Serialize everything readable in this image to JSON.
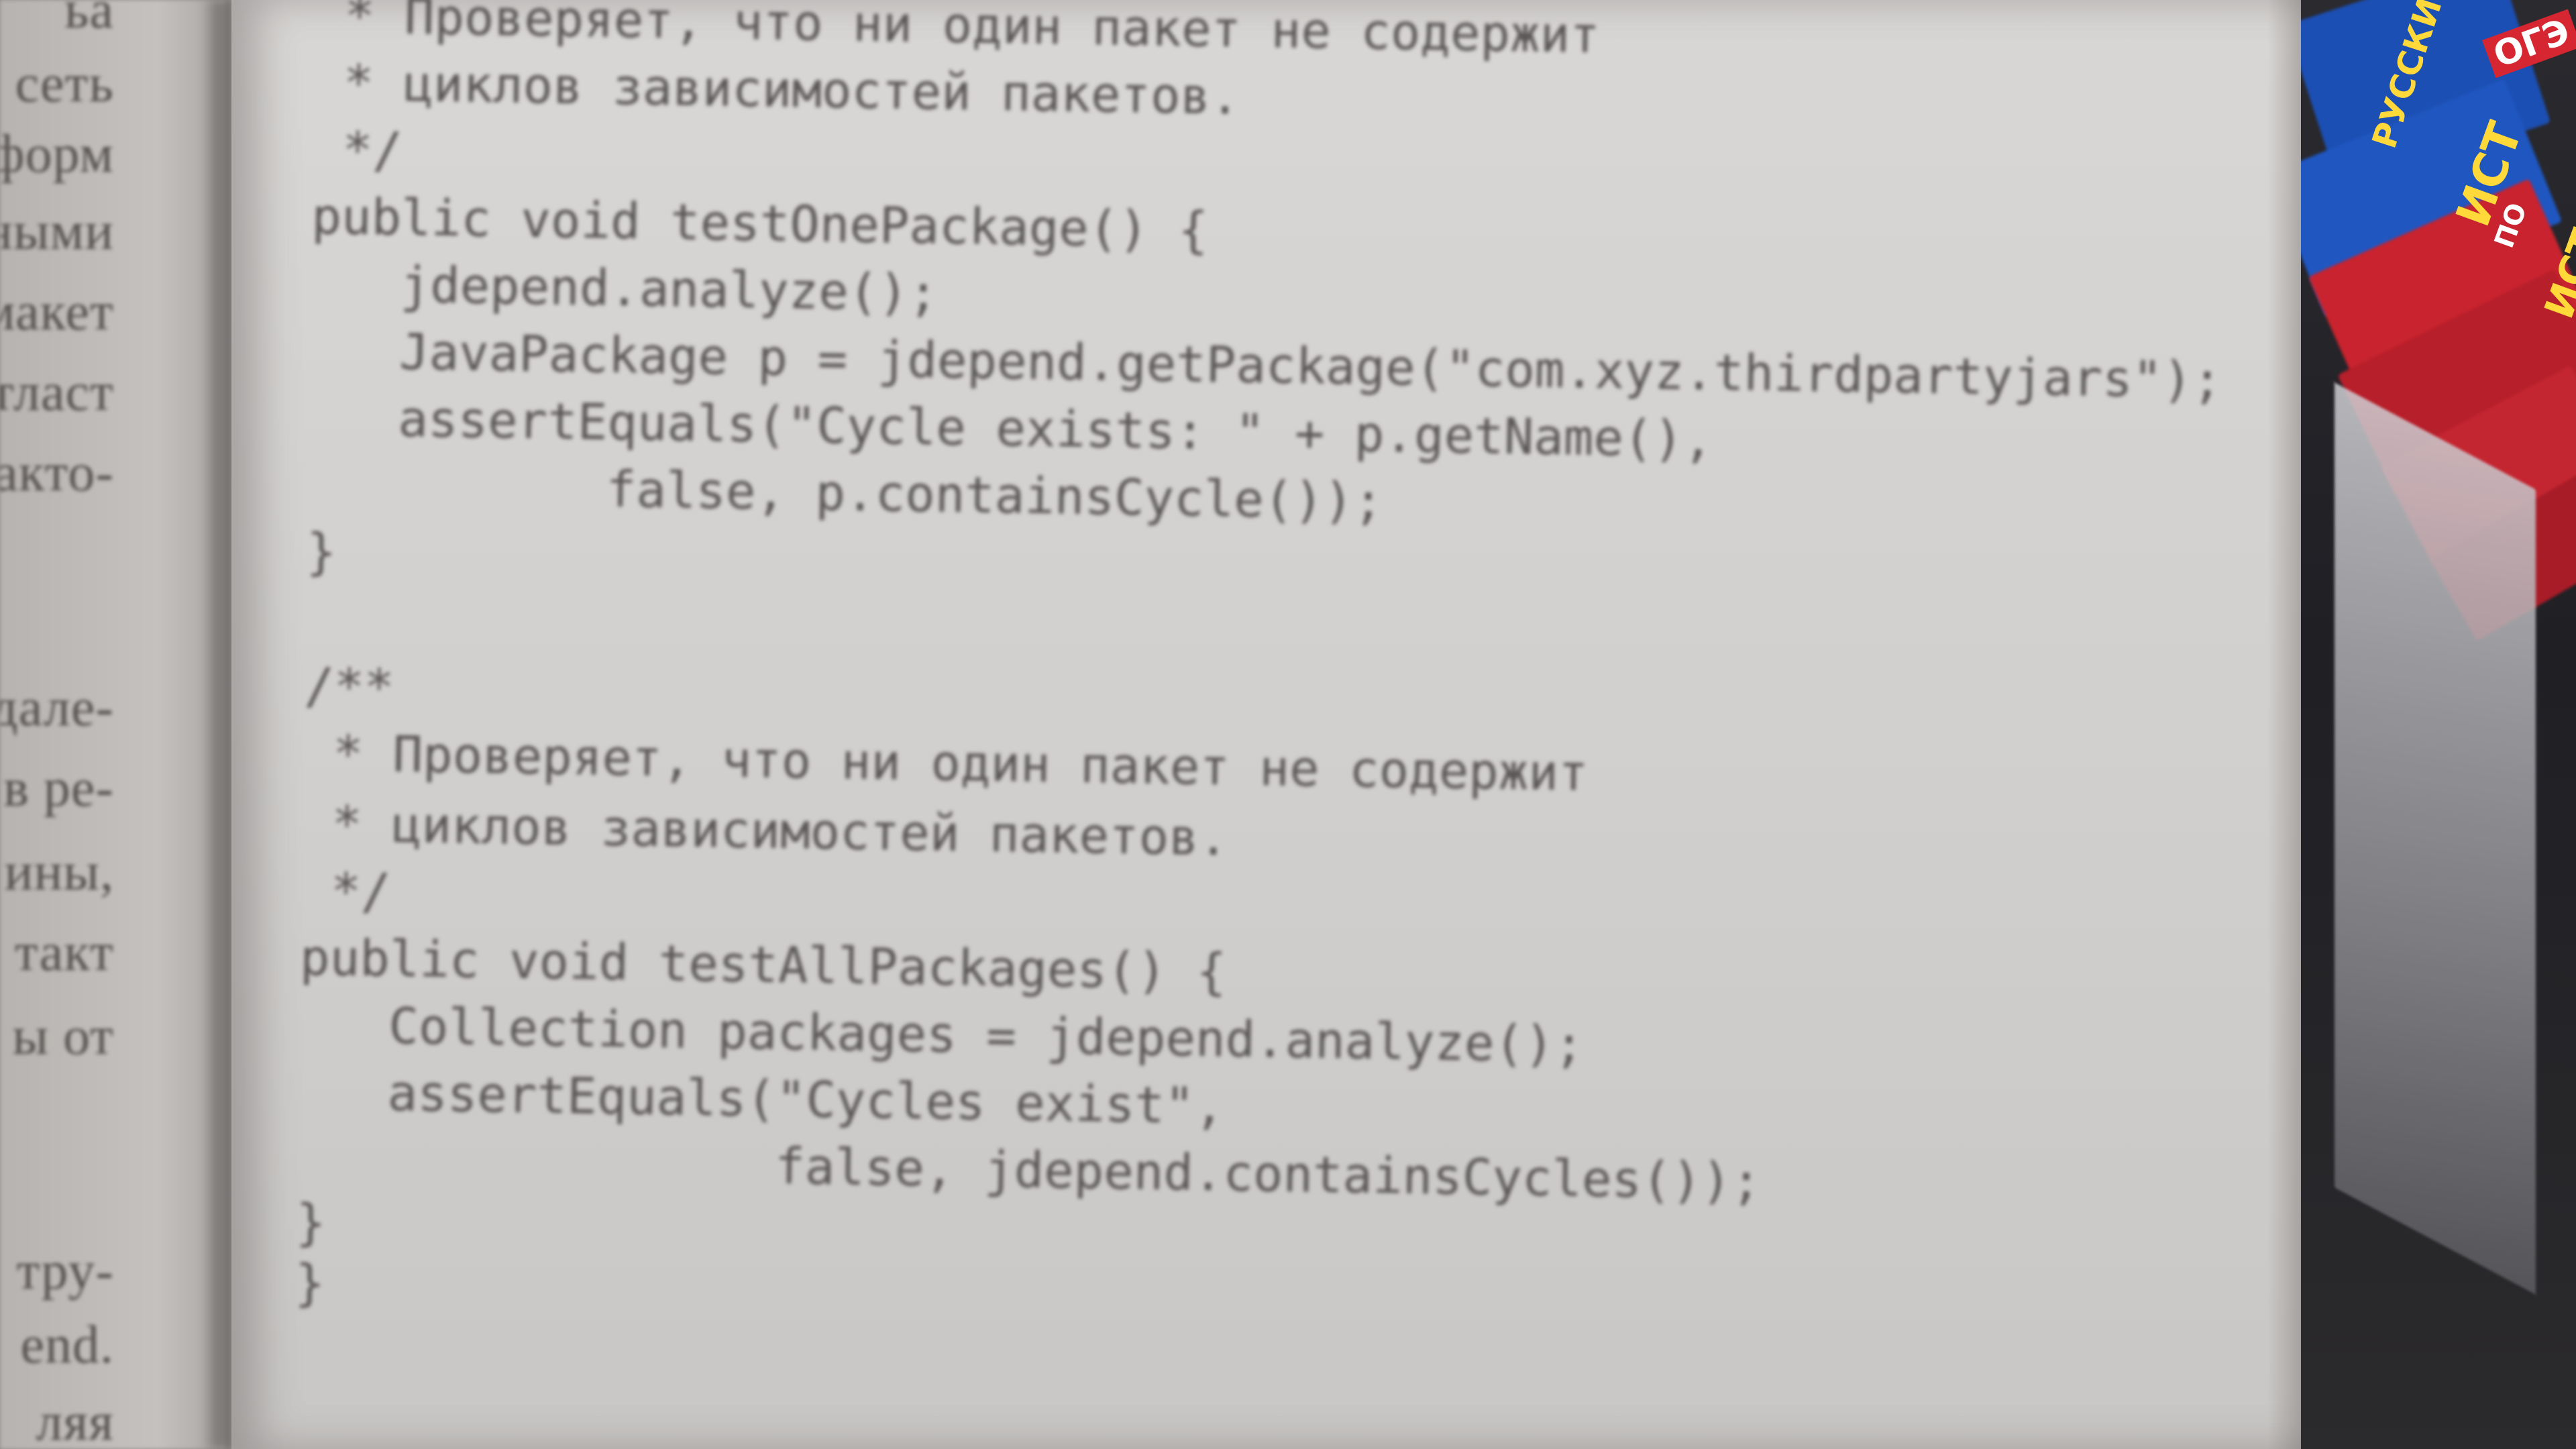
{
  "left_page": {
    "fragments": [
      "ьа",
      "ь сеть",
      "форм",
      "ными",
      "макет",
      "тласт",
      "акто-",
      "дале-",
      "в ре-",
      "ины,",
      "такт",
      "ы от",
      "тру-",
      "end.",
      "ляя"
    ]
  },
  "code": {
    "lines": [
      " * Проверяет, что ни один пакет не содержит",
      " * циклов зависимостей пакетов.",
      " */",
      "public void testOnePackage() {",
      "   jdepend.analyze();",
      "   JavaPackage p = jdepend.getPackage(\"com.xyz.thirdpartyjars\");",
      "   assertEquals(\"Cycle exists: \" + p.getName(),",
      "          false, p.containsCycle());",
      "}",
      "",
      "/**",
      " * Проверяет, что ни один пакет не содержит",
      " * циклов зависимостей пакетов.",
      " */",
      "public void testAllPackages() {",
      "   Collection packages = jdepend.analyze();",
      "   assertEquals(\"Cycles exist\",",
      "                false, jdepend.containsCycles());",
      "}",
      "}"
    ]
  },
  "shelf": {
    "book_labels": [
      "РУССКИЙ ЯЗЫК",
      "ОГЭ",
      "ИСТ",
      "ПО",
      "ИСТ"
    ]
  },
  "colors": {
    "paper": "#d6d4d2",
    "ink": "#5a5657",
    "book_blue": "#1c4fb3",
    "book_red": "#c8232e",
    "label_yellow": "#ffd83a"
  }
}
